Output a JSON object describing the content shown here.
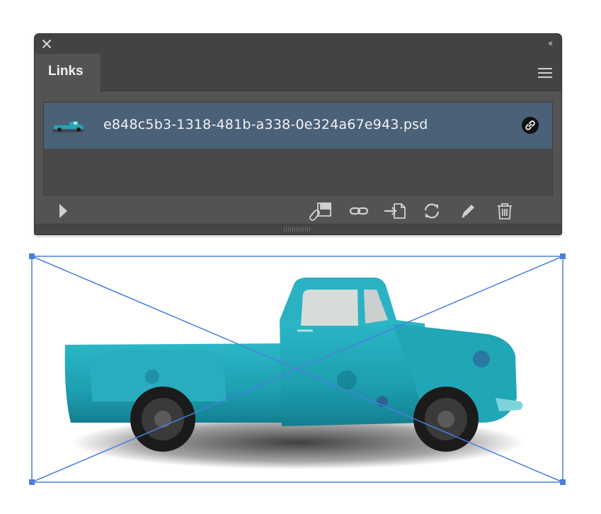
{
  "panel": {
    "tab_label": "Links",
    "collapse_glyph": "‹‹",
    "icons": [
      "close-icon",
      "collapse-icon",
      "panel-menu-icon"
    ]
  },
  "links": [
    {
      "filename": "e848c5b3-1318-481b-a338-0e324a67e943.psd",
      "status_icon": "linked-icon",
      "selected": true
    }
  ],
  "footer": {
    "buttons": [
      "show-info-triangle-icon",
      "relink-from-cc-libraries-icon",
      "relink-icon",
      "go-to-link-icon",
      "update-link-icon",
      "edit-original-icon",
      "delete-icon"
    ]
  },
  "colors": {
    "panel_bg": "#535353",
    "selection": "#4b6178",
    "frame_stroke": "#4a7fe0",
    "truck": "#1fa4b3"
  }
}
